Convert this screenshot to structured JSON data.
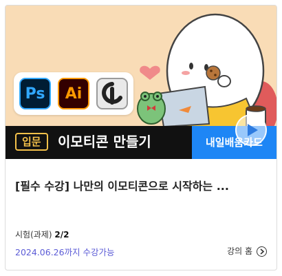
{
  "course_card": {
    "thumbnail": {
      "level_badge": "입문",
      "banner_title": "이모티콘 만들기",
      "blue_box_text": "내일배움카드",
      "apps": [
        {
          "label": "Ps",
          "icon": "photoshop-icon"
        },
        {
          "label": "Ai",
          "icon": "illustrator-icon"
        },
        {
          "label": "",
          "icon": "clip-studio-icon"
        }
      ]
    },
    "title": "[필수 수강] 나만의 이모티콘으로 시작하는 ...",
    "exam_label": "시험(과제)",
    "exam_value": "2/2",
    "deadline": "2024.06.26까지 수강가능",
    "home_link": "강의 홈"
  },
  "colors": {
    "thumbnail_bg": "#f9dcb6",
    "banner_bg": "#111111",
    "badge": "#f5c14a",
    "blue_box": "#1e86f5",
    "deadline_text": "#5b5bd6"
  }
}
